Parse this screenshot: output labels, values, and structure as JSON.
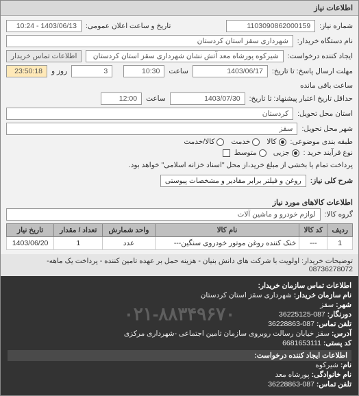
{
  "panel_title": "اطلاعات نیاز",
  "fields": {
    "need_no_label": "شماره نیاز:",
    "need_no": "1103090862000159",
    "announce_label": "تاریخ و ساعت اعلان عمومی:",
    "announce_value": "1403/06/13 - 10:24",
    "buyer_label": "نام دستگاه خریدار:",
    "buyer": "شهرداری سقز استان کردستان",
    "requester_label": "ایجاد کننده درخواست:",
    "requester": "شیرکوه پورشاه معد آتش نشان شهرداری سقز استان کردستان",
    "buyer_contact_btn": "اطلاعات تماس خریدار",
    "deadline_label": "مهلت ارسال پاسخ: تا تاریخ:",
    "deadline_date": "1403/06/17",
    "time_label1": "ساعت",
    "deadline_time": "10:30",
    "days_remaining_prefix": "",
    "days_remaining": "3",
    "days_remaining_label": "روز و",
    "time_remaining": "23:50:18",
    "time_remaining_label": "ساعت باقی مانده",
    "validity_label": "حداقل تاریخ اعتبار پیشنهاد: تا تاریخ:",
    "validity_date": "1403/07/30",
    "time_label2": "ساعت",
    "validity_time": "12:00",
    "province_label": "استان محل تحویل:",
    "province": "کردستان",
    "city_label": "شهر محل تحویل:",
    "city": "سقز",
    "classify_label": "طبقه بندی موضوعی:",
    "classify_goods": "کالا",
    "classify_service": "خدمت",
    "classify_both": "کالا/خدمت",
    "buy_type_label": "نوع فرآیند خرید :",
    "buy_type_partial": "جزیی",
    "buy_type_medium": "متوسط",
    "buy_note": "پرداخت تمام یا بخشی از مبلغ خرید،از محل \"اسناد خزانه اسلامی\" خواهد بود.",
    "need_title_label": "شرح کلی نیاز:",
    "need_title": "روغن و فیلتر برابر مقادیر و مشخصات پیوستی"
  },
  "items_section_title": "اطلاعات کالاهای مورد نیاز",
  "group_label": "گروه کالا:",
  "group_value": "لوازم خودرو و ماشین آلات",
  "table": {
    "headers": [
      "ردیف",
      "کد کالا",
      "نام کالا",
      "واحد شمارش",
      "تعداد / مقدار",
      "تاریخ نیاز"
    ],
    "rows": [
      {
        "idx": "1",
        "code": "---",
        "name": "خنک کننده روغن موتور خودروی سنگین---",
        "unit": "عدد",
        "qty": "1",
        "date": "1403/06/20"
      }
    ]
  },
  "buyer_remark_label": "توضیحات خریدار:",
  "buyer_remark": "اولویت با شرکت های دانش بنیان - هزینه حمل بر عهده تامین کننده - پرداخت یک ماهه- 08736278072",
  "contact": {
    "section_title": "اطلاعات تماس سازمان خریدار:",
    "org_label": "نام سازمان خریدار:",
    "org": "شهرداری سقز استان کردستان",
    "city_label": "شهر:",
    "city": "سقز",
    "fax_label": "دورنگار:",
    "fax": "087-36225125",
    "tel_label": "تلفن تماس:",
    "tel": "087-36228863",
    "addr_label": "آدرس:",
    "addr": "سقز خیابان رسالت روبروی سازمان تامین اجتماعی -شهرداری مرکزی",
    "post_label": "کد پستی:",
    "post": "6681653111",
    "requester_section": "اطلاعات ایجاد کننده درخواست:",
    "r_name_label": "نام:",
    "r_name": "شیرکوه",
    "r_family_label": "نام خانوادگی:",
    "r_family": "پورشاه معد",
    "r_tel_label": "تلفن تماس:",
    "r_tel": "087-36228863",
    "watermark": "۰۲۱-۸۸۳۴۹۶۷۰"
  }
}
